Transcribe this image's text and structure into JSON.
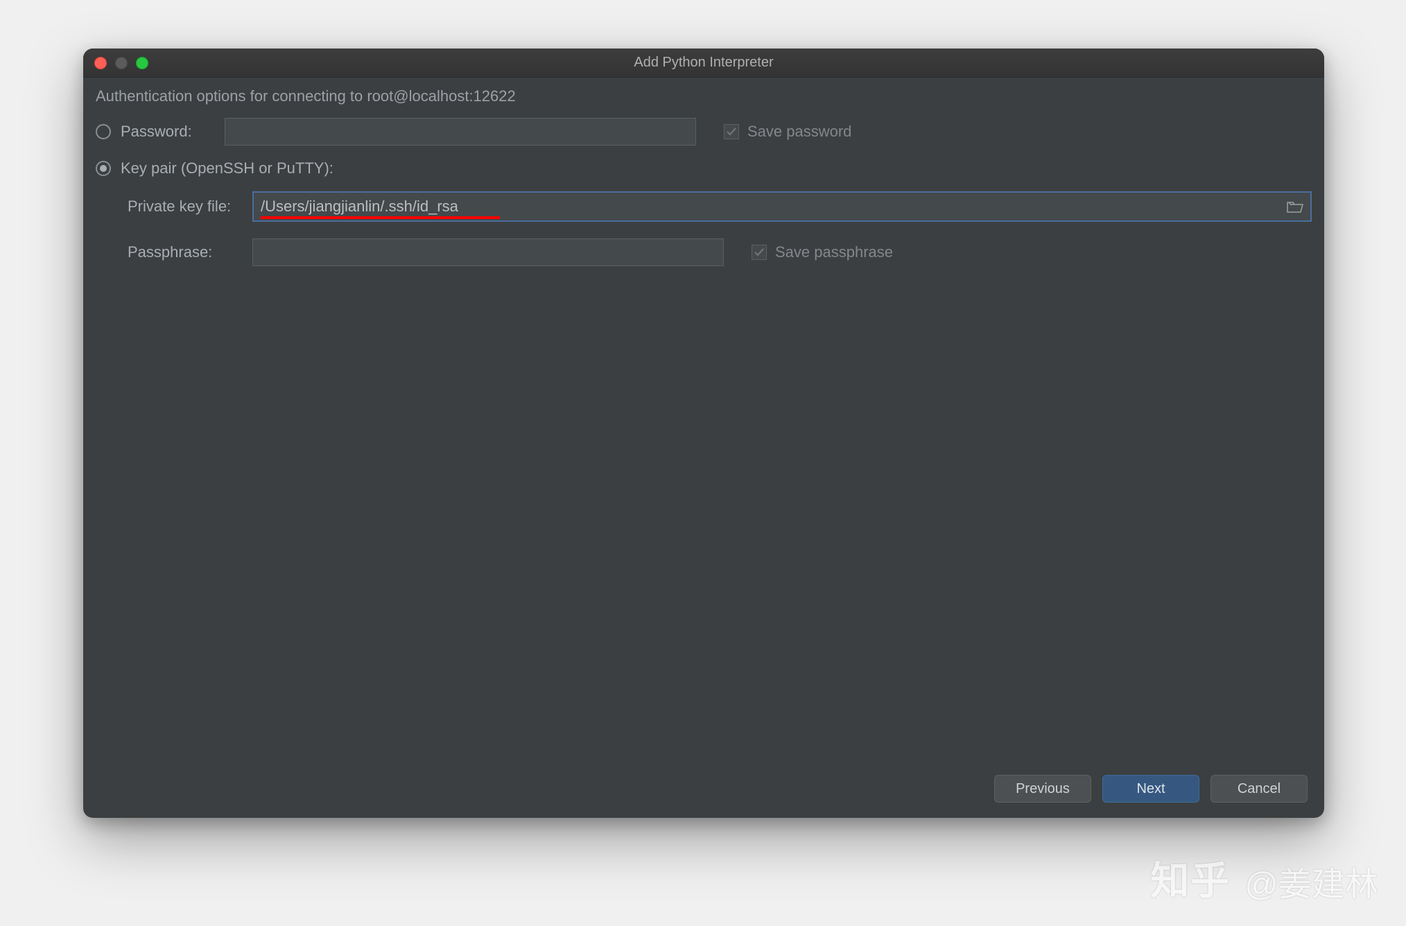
{
  "window": {
    "title": "Add Python Interpreter"
  },
  "header": {
    "subtitle": "Authentication options for connecting to root@localhost:12622"
  },
  "auth": {
    "password": {
      "label": "Password:",
      "value": "",
      "save_label": "Save password"
    },
    "keypair": {
      "label": "Key pair (OpenSSH or PuTTY):",
      "private_key_label": "Private key file:",
      "private_key_value": "/Users/jiangjianlin/.ssh/id_rsa",
      "passphrase_label": "Passphrase:",
      "passphrase_value": "",
      "save_label": "Save passphrase"
    }
  },
  "buttons": {
    "previous": "Previous",
    "next": "Next",
    "cancel": "Cancel"
  },
  "watermark": {
    "logo": "知乎",
    "author": "@姜建林"
  },
  "colors": {
    "bg": "#3c3f41",
    "accent": "#365880",
    "underline": "#ff0000"
  }
}
